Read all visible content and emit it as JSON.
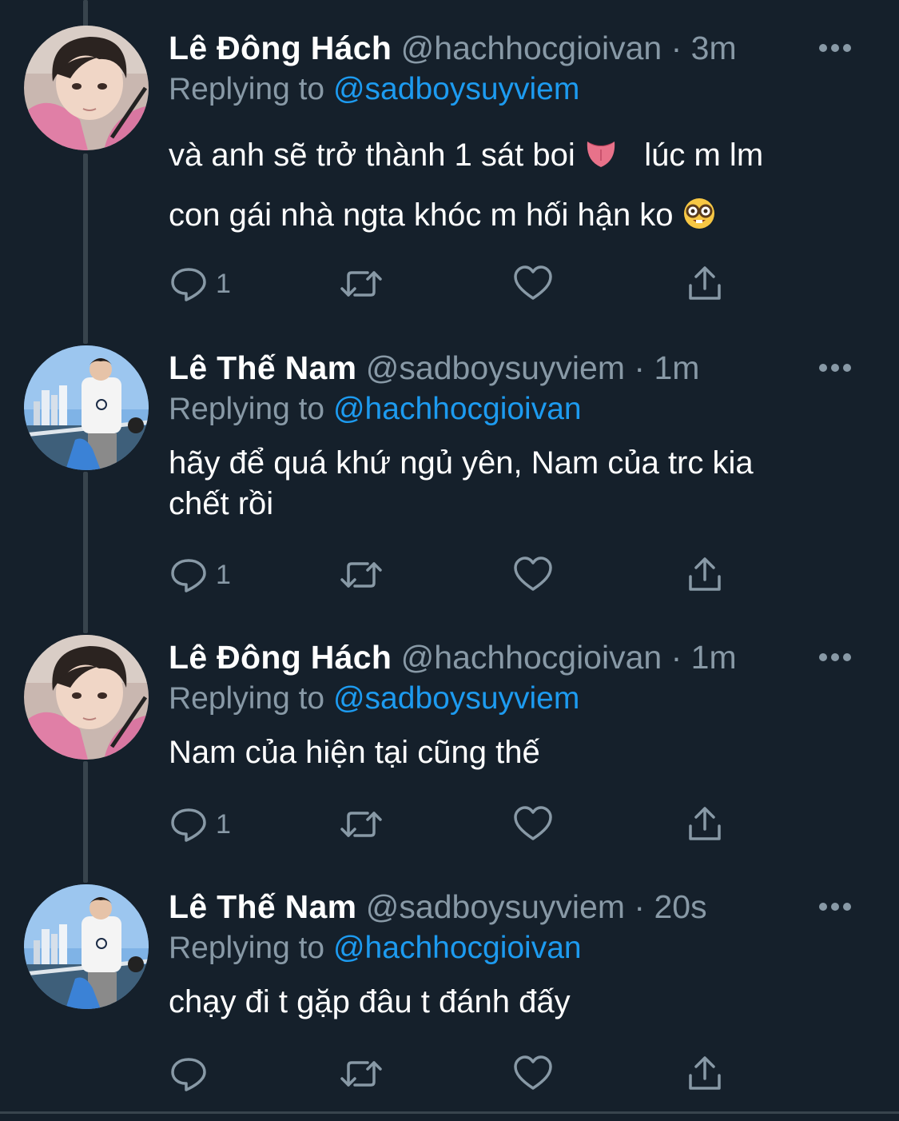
{
  "colors": {
    "background": "#15202b",
    "text_primary": "#ffffff",
    "text_secondary": "#8899a6",
    "link": "#1d9bf0",
    "thread_line": "#38444d"
  },
  "tweets": [
    {
      "name": "Lê Đông Hách",
      "handle": "@hachhocgioivan",
      "dot": "·",
      "time": "3m",
      "replying_prefix": "Replying to",
      "replying_to": "@sadboysuyviem",
      "text_line1_a": "và anh sẽ trở thành 1 sát boi",
      "text_line1_b": "lúc m lm",
      "text_line2": "con gái nhà ngta khóc m hối hận ko",
      "emoji_1": "tongue-emoji",
      "emoji_2": "nerd-face-emoji",
      "reply_count": "1",
      "avatar": "avatar-pink-hoodie"
    },
    {
      "name": "Lê Thế Nam",
      "handle": "@sadboysuyviem",
      "dot": "·",
      "time": "1m",
      "replying_prefix": "Replying to",
      "replying_to": "@hachhocgioivan",
      "text_line1": "hãy để quá khứ ngủ yên, Nam của trc kia",
      "text_line2": "chết rồi",
      "reply_count": "1",
      "avatar": "avatar-boat-city"
    },
    {
      "name": "Lê Đông Hách",
      "handle": "@hachhocgioivan",
      "dot": "·",
      "time": "1m",
      "replying_prefix": "Replying to",
      "replying_to": "@sadboysuyviem",
      "text_line1": "Nam của hiện tại cũng thế",
      "reply_count": "1",
      "avatar": "avatar-pink-hoodie"
    },
    {
      "name": "Lê Thế Nam",
      "handle": "@sadboysuyviem",
      "dot": "·",
      "time": "20s",
      "replying_prefix": "Replying to",
      "replying_to": "@hachhocgioivan",
      "text_line1": "chạy đi t gặp đâu t đánh đấy",
      "reply_count": "",
      "avatar": "avatar-boat-city"
    }
  ],
  "icons": {
    "reply": "reply-icon",
    "retweet": "retweet-icon",
    "like": "heart-icon",
    "share": "share-icon",
    "more": "more-icon"
  }
}
